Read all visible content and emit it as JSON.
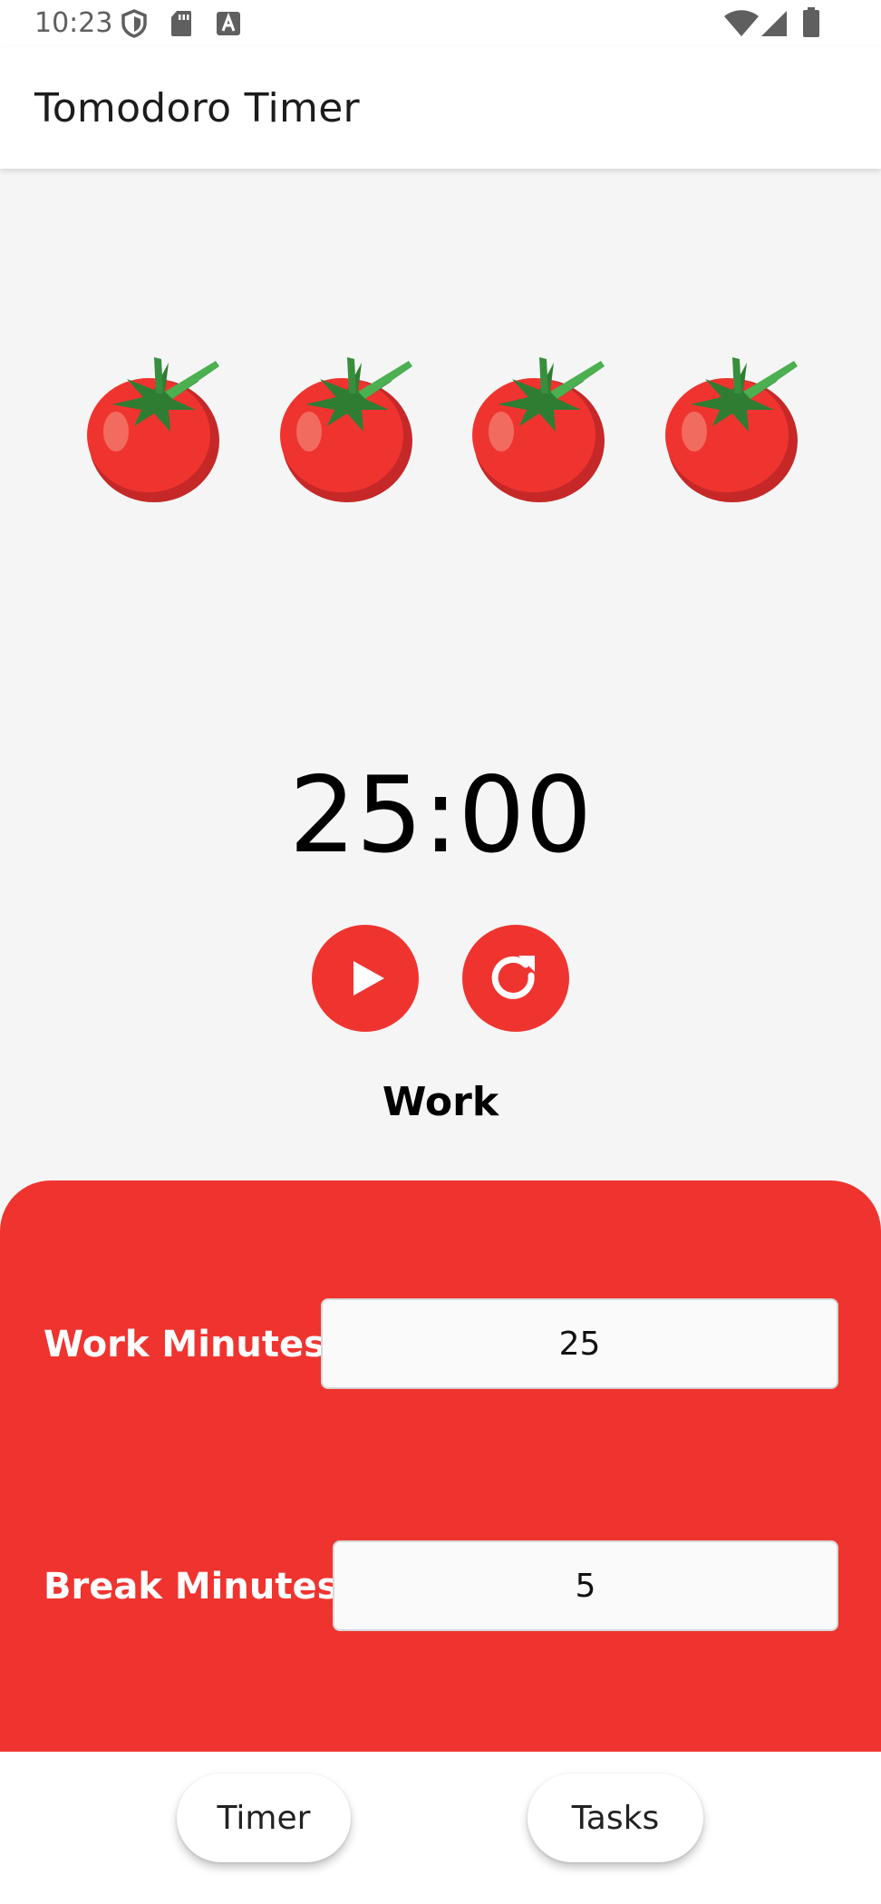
{
  "status_bar": {
    "time": "10:23",
    "left_icons": [
      "shield-icon",
      "sd-card-icon",
      "font-a-icon"
    ],
    "right_icons": [
      "wifi-icon",
      "signal-icon",
      "battery-icon"
    ]
  },
  "app_bar": {
    "title": "Tomodoro Timer"
  },
  "tomatoes": {
    "count": 4,
    "icon": "tomato-icon"
  },
  "timer": {
    "display": "25:00",
    "play_icon": "play-icon",
    "reset_icon": "refresh-icon",
    "mode": "Work"
  },
  "settings": {
    "work_label": "Work Minutes:",
    "work_value": "25",
    "break_label": "Break Minutes:",
    "break_value": "5"
  },
  "nav": {
    "timer_label": "Timer",
    "tasks_label": "Tasks"
  },
  "colors": {
    "accent": "#ef3430",
    "background": "#f5f5f5",
    "panel_text": "#ffffff"
  }
}
